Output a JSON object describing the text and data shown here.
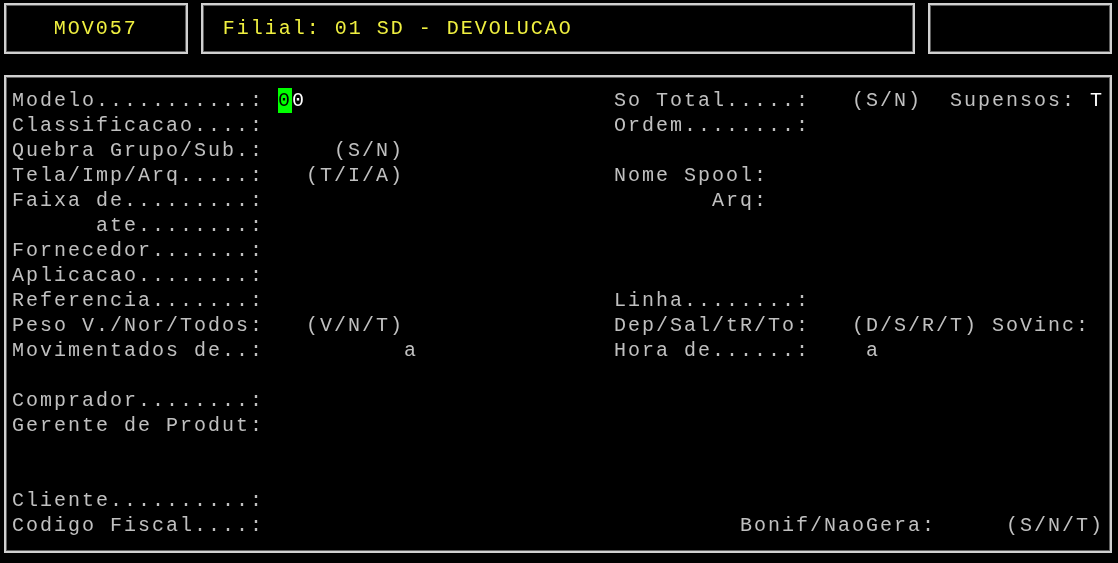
{
  "header": {
    "program": "MOV057",
    "branch": "Filial: 01 SD - DEVOLUCAO"
  },
  "items": [
    {
      "kind": "label",
      "text": "Modelo...........:"
    },
    {
      "kind": "value",
      "text": "00",
      "cursor": true
    },
    {
      "kind": "label",
      "text": "So Total.....:"
    },
    {
      "kind": "hint",
      "text": "(S/N)"
    },
    {
      "kind": "label",
      "text": "Supensos:"
    },
    {
      "kind": "value",
      "text": "T",
      "cursor": false
    },
    {
      "kind": "label",
      "text": "Classificacao....:"
    },
    {
      "kind": "label",
      "text": "Ordem........:"
    },
    {
      "kind": "label",
      "text": "Quebra Grupo/Sub.:"
    },
    {
      "kind": "hint",
      "text": "(S/N)"
    },
    {
      "kind": "label",
      "text": "Tela/Imp/Arq.....:"
    },
    {
      "kind": "hint",
      "text": "(T/I/A)"
    },
    {
      "kind": "label",
      "text": "Nome Spool:"
    },
    {
      "kind": "label",
      "text": "Faixa de.........:"
    },
    {
      "kind": "label",
      "text": "Arq:"
    },
    {
      "kind": "label",
      "text": "ate........:"
    },
    {
      "kind": "label",
      "text": "Fornecedor.......:"
    },
    {
      "kind": "label",
      "text": "Aplicacao........:"
    },
    {
      "kind": "label",
      "text": "Referencia.......:"
    },
    {
      "kind": "label",
      "text": "Linha........:"
    },
    {
      "kind": "label",
      "text": "Peso V./Nor/Todos:"
    },
    {
      "kind": "hint",
      "text": "(V/N/T)"
    },
    {
      "kind": "label",
      "text": "Dep/Sal/tR/To:"
    },
    {
      "kind": "hint",
      "text": "(D/S/R/T)"
    },
    {
      "kind": "label",
      "text": "SoVinc:"
    },
    {
      "kind": "label",
      "text": "Movimentados de..:"
    },
    {
      "kind": "hint",
      "text": "a"
    },
    {
      "kind": "label",
      "text": "Hora de......:"
    },
    {
      "kind": "hint",
      "text": "a"
    },
    {
      "kind": "label",
      "text": "Comprador........:"
    },
    {
      "kind": "label",
      "text": "Gerente de Produt:"
    },
    {
      "kind": "label",
      "text": "Cliente..........:"
    },
    {
      "kind": "label",
      "text": "Codigo Fiscal....:"
    },
    {
      "kind": "label",
      "text": "Bonif/NaoGera:"
    },
    {
      "kind": "hint",
      "text": "(S/N/T)"
    }
  ]
}
